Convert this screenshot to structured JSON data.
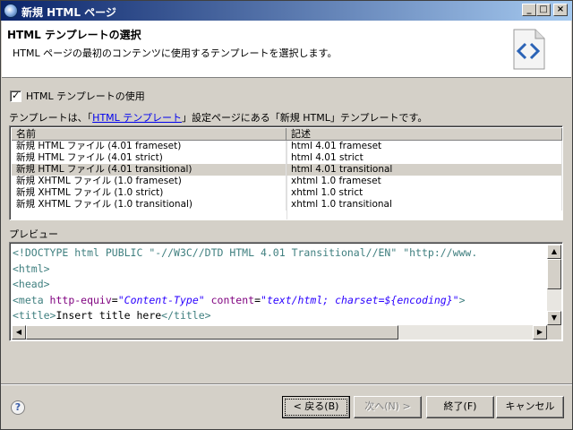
{
  "window": {
    "title": "新規 HTML ページ",
    "icon": "eclipse-icon"
  },
  "header": {
    "title": "HTML テンプレートの選択",
    "description": "HTML ページの最初のコンテンツに使用するテンプレートを選択します。",
    "icon": "html-wizard-icon"
  },
  "use_template": {
    "label": "HTML テンプレートの使用",
    "checked": true
  },
  "info": {
    "prefix": "テンプレートは、「",
    "link": "HTML テンプレート",
    "suffix": "」設定ページにある「新規 HTML」テンプレートです。"
  },
  "table": {
    "columns": [
      "名前",
      "記述"
    ],
    "rows": [
      {
        "name": "新規 HTML ファイル (4.01 frameset)",
        "desc": "html 4.01 frameset"
      },
      {
        "name": "新規 HTML ファイル (4.01 strict)",
        "desc": "html 4.01 strict"
      },
      {
        "name": "新規 HTML ファイル (4.01 transitional)",
        "desc": "html 4.01 transitional"
      },
      {
        "name": "新規 XHTML ファイル (1.0 frameset)",
        "desc": "xhtml 1.0 frameset"
      },
      {
        "name": "新規 XHTML ファイル (1.0 strict)",
        "desc": "xhtml 1.0 strict"
      },
      {
        "name": "新規 XHTML ファイル (1.0 transitional)",
        "desc": "xhtml 1.0 transitional"
      }
    ],
    "selected_index": 2
  },
  "preview": {
    "label": "プレビュー",
    "lines": {
      "l1_tag": "<!DOCTYPE html PUBLIC ",
      "l1_str": "\"-//W3C//DTD HTML 4.01 Transitional//EN\" \"http://www.",
      "l2": "<html>",
      "l3": "<head>",
      "l4_open": "<meta ",
      "l4_attr1": "http-equiv",
      "l4_eq1": "=",
      "l4_val1": "\"Content-Type\"",
      "l4_sp": " ",
      "l4_attr2": "content",
      "l4_eq2": "=",
      "l4_val2": "\"text/html; charset=${encoding}\"",
      "l4_close": ">",
      "l5_open": "<title>",
      "l5_text": "Insert title here",
      "l5_close": "</title>"
    }
  },
  "buttons": {
    "help_label": "?",
    "back": "< 戻る(B)",
    "next": "次へ(N) >",
    "finish": "終了(F)",
    "cancel": "キャンセル"
  },
  "window_controls": {
    "minimize": "_",
    "maximize": "□",
    "close": "×"
  }
}
